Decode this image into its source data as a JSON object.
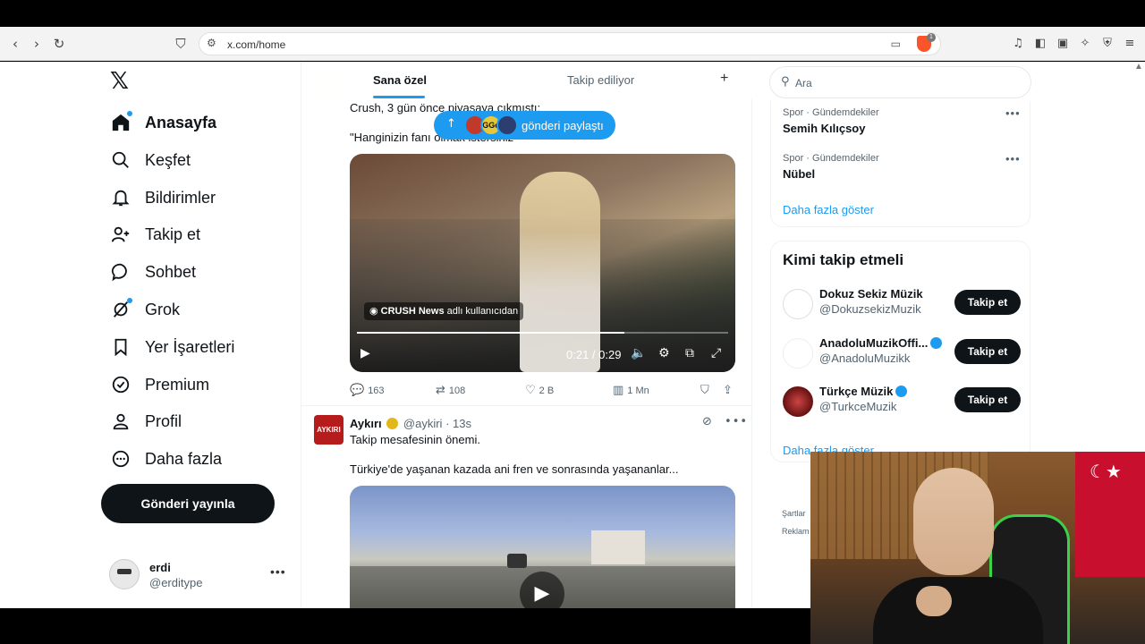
{
  "browser": {
    "url": "x.com/home",
    "brave_badge": "1"
  },
  "nav": {
    "items": [
      {
        "label": "Anasayfa"
      },
      {
        "label": "Keşfet"
      },
      {
        "label": "Bildirimler"
      },
      {
        "label": "Takip et"
      },
      {
        "label": "Sohbet"
      },
      {
        "label": "Grok"
      },
      {
        "label": "Yer İşaretleri"
      },
      {
        "label": "Premium"
      },
      {
        "label": "Profil"
      },
      {
        "label": "Daha fazla"
      }
    ],
    "post_button": "Gönderi yayınla",
    "profile": {
      "name": "erdi",
      "handle": "@erditype"
    }
  },
  "feed": {
    "tabs": [
      {
        "label": "Sana özel"
      },
      {
        "label": "Takip ediliyor"
      }
    ],
    "new_posts_pill": "gönderi paylaştı",
    "pill_avatar_text": "GGo",
    "tweet1": {
      "text_line1": "Crush, 3 gün önce piyasaya çıkmıştı;",
      "text_line2": "\"Hanginizin fanı olmak istersiniz\"",
      "video_source_name": "CRUSH News",
      "video_source_suffix": "adlı kullanıcıdan",
      "video_time": "0:21 / 0:29",
      "video_progress": 0.72,
      "replies": "163",
      "reposts": "108",
      "likes": "2 B",
      "views": "1 Mn"
    },
    "tweet2": {
      "author": "Aykırı",
      "handle": "@aykiri",
      "time": "13s",
      "avatar_text": "AYKIRI",
      "text_line1": "Takip mesafesinin önemi.",
      "text_line2": "Türkiye'de yaşanan kazada ani fren ve sonrasında yaşananlar..."
    }
  },
  "sidebar": {
    "search_placeholder": "Ara",
    "trends": [
      {
        "category": "Spor · Gündemdekiler",
        "name": "Semih Kılıçsoy"
      },
      {
        "category": "Spor · Gündemdekiler",
        "name": "Nübel"
      }
    ],
    "show_more": "Daha fazla göster",
    "who_to_follow_title": "Kimi takip etmeli",
    "who_to_follow": [
      {
        "name": "Dokuz Sekiz Müzik",
        "handle": "@DokuzsekizMuzik",
        "verified": false,
        "button": "Takip et"
      },
      {
        "name": "AnadoluMuzikOffi...",
        "handle": "@AnadoluMuzikk",
        "verified": true,
        "button": "Takip et"
      },
      {
        "name": "Türkçe Müzik",
        "handle": "@TurkceMuzik",
        "verified": true,
        "button": "Takip et"
      }
    ],
    "show_more2": "Daha fazla göster",
    "footer1": "Şartlar",
    "footer2": "Reklam"
  }
}
